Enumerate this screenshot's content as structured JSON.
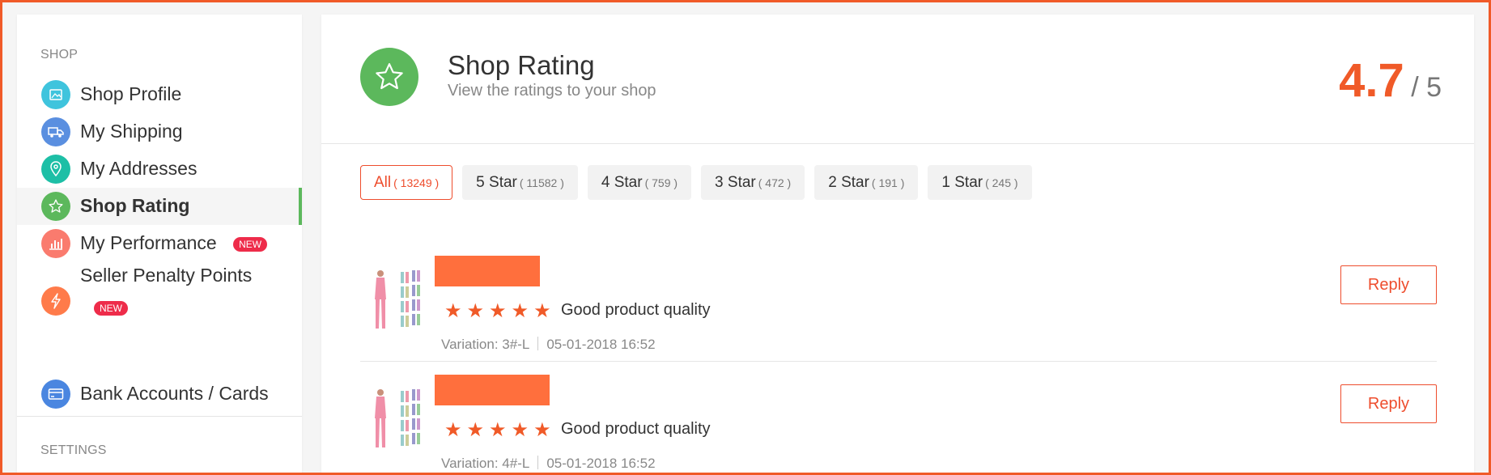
{
  "sidebar": {
    "section_shop": "SHOP",
    "items": [
      {
        "label": "Shop Profile",
        "icon": "image-icon",
        "color": "#3fc4dd"
      },
      {
        "label": "My Shipping",
        "icon": "truck-icon",
        "color": "#5a8fe0"
      },
      {
        "label": "My Addresses",
        "icon": "location-pin-icon",
        "color": "#1dbfa6"
      },
      {
        "label": "Shop Rating",
        "icon": "star-icon",
        "color": "#5cb85c",
        "active": true
      },
      {
        "label": "My Performance",
        "icon": "bar-chart-icon",
        "color": "#fa7b6e",
        "badge": "NEW"
      },
      {
        "label": "Seller Penalty Points",
        "icon": "lightning-icon",
        "color": "#ff7b4a",
        "badge": "NEW"
      },
      {
        "label": "Bank Accounts / Cards",
        "icon": "credit-card-icon",
        "color": "#4a86e0"
      }
    ],
    "section_settings": "SETTINGS"
  },
  "header": {
    "title": "Shop Rating",
    "subtitle": "View the ratings to your shop",
    "score": "4.7",
    "score_suffix": "/ 5",
    "icon": "star-icon",
    "icon_color": "#5cb85c"
  },
  "filters": [
    {
      "label": "All",
      "count": "( 13249 )",
      "active": true
    },
    {
      "label": "5 Star",
      "count": "( 11582 )"
    },
    {
      "label": "4 Star",
      "count": "( 759 )"
    },
    {
      "label": "3 Star",
      "count": "( 472 )"
    },
    {
      "label": "2 Star",
      "count": "( 191 )"
    },
    {
      "label": "1 Star",
      "count": "( 245 )"
    }
  ],
  "reviews": [
    {
      "stars": "★★★★★",
      "rating": 5,
      "text": "Good product quality",
      "variation": "Variation: 3#-L",
      "date": "05-01-2018 16:52",
      "reply": "Reply"
    },
    {
      "stars": "★★★★★",
      "rating": 5,
      "text": "Good product quality",
      "variation": "Variation: 4#-L",
      "date": "05-01-2018 16:52",
      "reply": "Reply"
    }
  ],
  "colors": {
    "accent": "#ee4d2d",
    "frame": "#f05a28",
    "redacted_name": "#ff6f3d"
  }
}
